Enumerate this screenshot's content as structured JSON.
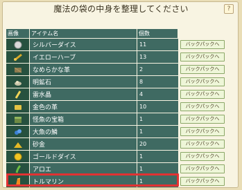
{
  "title": "魔法の袋の中身を整理してください",
  "help_label": "?",
  "table_header": {
    "image_label": "画像",
    "name_label": "アイテム名",
    "count_label": "個数"
  },
  "rows": [
    {
      "name": "シルバーダイス",
      "qty": "11",
      "button": "バックパックへ",
      "icon": "silver-dice-icon"
    },
    {
      "name": "イエローハーブ",
      "qty": "13",
      "button": "バックパックへ",
      "icon": "yellow-herb-icon"
    },
    {
      "name": "なめらかな革",
      "qty": "2",
      "button": "バックパックへ",
      "icon": "smooth-leather-icon"
    },
    {
      "name": "明鉱石",
      "qty": "8",
      "button": "バックパックへ",
      "icon": "ore-icon"
    },
    {
      "name": "雷水晶",
      "qty": "4",
      "button": "バックパックへ",
      "icon": "thunder-crystal-icon"
    },
    {
      "name": "金色の革",
      "qty": "10",
      "button": "バックパックへ",
      "icon": "golden-leather-icon"
    },
    {
      "name": "怪魚の宝箱",
      "qty": "1",
      "button": "バックパックへ",
      "icon": "fish-treasure-chest-icon"
    },
    {
      "name": "大魚の鱗",
      "qty": "1",
      "button": "バックパックへ",
      "icon": "fish-scale-icon"
    },
    {
      "name": "砂金",
      "qty": "20",
      "button": "バックパックへ",
      "icon": "gold-dust-icon"
    },
    {
      "name": "ゴールドダイス",
      "qty": "1",
      "button": "バックパックへ",
      "icon": "gold-dice-icon"
    },
    {
      "name": "アロエ",
      "qty": "1",
      "button": "バックパックへ",
      "icon": "aloe-icon"
    },
    {
      "name": "トルマリン",
      "qty": "1",
      "button": "バックパックへ",
      "icon": "tourmaline-icon"
    }
  ],
  "colors": {
    "header_bg": "#3f6a62",
    "image_cell_bg": "#27513f",
    "button_bg": "#eef6d8",
    "highlight": "#e23232"
  }
}
